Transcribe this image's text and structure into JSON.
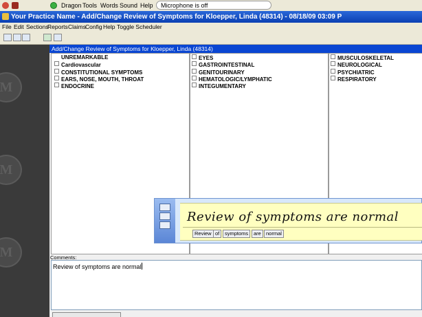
{
  "dragon_bar": {
    "menus": [
      "Dragon",
      "Tools",
      "Words",
      "Sound",
      "Help"
    ],
    "mic_status": "Microphone is off"
  },
  "window": {
    "title": "Your Practice Name -  Add/Change Review of Symptoms for Kloepper, Linda (48314) - 08/18/09 03:09 P"
  },
  "menu_bar": [
    "File",
    "Edit",
    "Sections",
    "Reports",
    "Claims",
    "Config",
    "Help",
    "Toggle Scheduler"
  ],
  "dialog": {
    "title": "Add/Change Review of Symptoms for Kloepper, Linda (48314)",
    "columns": [
      [
        "UNREMARKABLE",
        "Cardiovascular",
        "CONSTITUTIONAL SYMPTOMS",
        "EARS, NOSE, MOUTH, THROAT",
        "ENDOCRINE"
      ],
      [
        "EYES",
        "GASTROINTESTINAL",
        "GENITOURINARY",
        "HEMATOLOGIC/LYMPHATIC",
        "INTEGUMENTARY"
      ],
      [
        "MUSCULOSKELETAL",
        "NEUROLOGICAL",
        "PSYCHIATRIC",
        "RESPIRATORY"
      ]
    ],
    "comments_label": "Comments:",
    "comments_value": "Review of symptoms are normal"
  },
  "dragon_panel": {
    "handwriting": "Review of symptoms are normal",
    "words": [
      "Review",
      "of",
      "symptoms",
      "are",
      "normal"
    ]
  },
  "colors": {
    "title_bar": "#0a46d2",
    "left_panel": "#3a3a3a",
    "ink_pad": "#ffffc0"
  }
}
